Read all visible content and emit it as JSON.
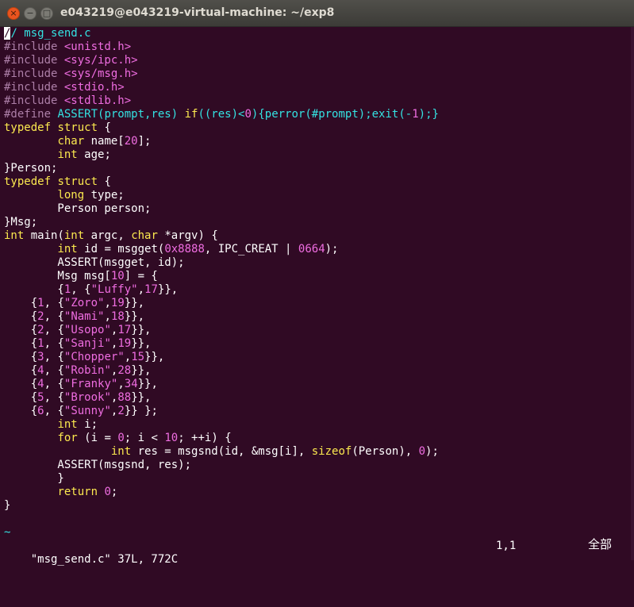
{
  "window": {
    "title": "e043219@e043219-virtual-machine: ~/exp8",
    "close_glyph": "×",
    "minimize_glyph": "−",
    "maximize_glyph": "□"
  },
  "colors": {
    "background": "#300a24",
    "comment": "#34e2e2",
    "preproc": "#ad7fa8",
    "type": "#fce94f",
    "statement": "#fce94f",
    "constant": "#ef6de1",
    "identifier": "#ffffff"
  },
  "editor": {
    "lines": [
      [
        [
          "cursor",
          "/"
        ],
        [
          "comment",
          "/ msg_send.c"
        ]
      ],
      [
        [
          "preproc",
          "#include "
        ],
        [
          "string",
          "<unistd.h>"
        ]
      ],
      [
        [
          "preproc",
          "#include "
        ],
        [
          "string",
          "<sys/ipc.h>"
        ]
      ],
      [
        [
          "preproc",
          "#include "
        ],
        [
          "string",
          "<sys/msg.h>"
        ]
      ],
      [
        [
          "preproc",
          "#include "
        ],
        [
          "string",
          "<stdio.h>"
        ]
      ],
      [
        [
          "preproc",
          "#include "
        ],
        [
          "string",
          "<stdlib.h>"
        ]
      ],
      [
        [
          "preproc",
          "#define "
        ],
        [
          "comment",
          "ASSERT(prompt,res) "
        ],
        [
          "type",
          "if"
        ],
        [
          "comment",
          "((res)<"
        ],
        [
          "constant",
          "0"
        ],
        [
          "comment",
          "){perror(#prompt);exit(-"
        ],
        [
          "constant",
          "1"
        ],
        [
          "comment",
          ");}"
        ]
      ],
      [
        [
          "type",
          "typedef"
        ],
        [
          "plain",
          " "
        ],
        [
          "type",
          "struct"
        ],
        [
          "plain",
          " {"
        ]
      ],
      [
        [
          "plain",
          "        "
        ],
        [
          "type",
          "char"
        ],
        [
          "plain",
          " name["
        ],
        [
          "constant",
          "20"
        ],
        [
          "plain",
          "];"
        ]
      ],
      [
        [
          "plain",
          "        "
        ],
        [
          "type",
          "int"
        ],
        [
          "plain",
          " age;"
        ]
      ],
      [
        [
          "plain",
          "}Person;"
        ]
      ],
      [
        [
          "type",
          "typedef"
        ],
        [
          "plain",
          " "
        ],
        [
          "type",
          "struct"
        ],
        [
          "plain",
          " {"
        ]
      ],
      [
        [
          "plain",
          "        "
        ],
        [
          "type",
          "long"
        ],
        [
          "plain",
          " type;"
        ]
      ],
      [
        [
          "plain",
          "        Person person;"
        ]
      ],
      [
        [
          "plain",
          "}Msg;"
        ]
      ],
      [
        [
          "type",
          "int"
        ],
        [
          "plain",
          " main("
        ],
        [
          "type",
          "int"
        ],
        [
          "plain",
          " argc, "
        ],
        [
          "type",
          "char"
        ],
        [
          "plain",
          " *argv) {"
        ]
      ],
      [
        [
          "plain",
          "        "
        ],
        [
          "type",
          "int"
        ],
        [
          "plain",
          " id = msgget("
        ],
        [
          "constant",
          "0x8888"
        ],
        [
          "plain",
          ", IPC_CREAT | "
        ],
        [
          "constant",
          "0664"
        ],
        [
          "plain",
          ");"
        ]
      ],
      [
        [
          "plain",
          "        ASSERT(msgget, id);"
        ]
      ],
      [
        [
          "plain",
          "        Msg msg["
        ],
        [
          "constant",
          "10"
        ],
        [
          "plain",
          "] = {"
        ]
      ],
      [
        [
          "plain",
          "        {"
        ],
        [
          "constant",
          "1"
        ],
        [
          "plain",
          ", {"
        ],
        [
          "constant",
          "\"Luffy\""
        ],
        [
          "plain",
          ","
        ],
        [
          "constant",
          "17"
        ],
        [
          "plain",
          "}},"
        ]
      ],
      [
        [
          "plain",
          "    {"
        ],
        [
          "constant",
          "1"
        ],
        [
          "plain",
          ", {"
        ],
        [
          "constant",
          "\"Zoro\""
        ],
        [
          "plain",
          ","
        ],
        [
          "constant",
          "19"
        ],
        [
          "plain",
          "}},"
        ]
      ],
      [
        [
          "plain",
          "    {"
        ],
        [
          "constant",
          "2"
        ],
        [
          "plain",
          ", {"
        ],
        [
          "constant",
          "\"Nami\""
        ],
        [
          "plain",
          ","
        ],
        [
          "constant",
          "18"
        ],
        [
          "plain",
          "}},"
        ]
      ],
      [
        [
          "plain",
          "    {"
        ],
        [
          "constant",
          "2"
        ],
        [
          "plain",
          ", {"
        ],
        [
          "constant",
          "\"Usopo\""
        ],
        [
          "plain",
          ","
        ],
        [
          "constant",
          "17"
        ],
        [
          "plain",
          "}},"
        ]
      ],
      [
        [
          "plain",
          "    {"
        ],
        [
          "constant",
          "1"
        ],
        [
          "plain",
          ", {"
        ],
        [
          "constant",
          "\"Sanji\""
        ],
        [
          "plain",
          ","
        ],
        [
          "constant",
          "19"
        ],
        [
          "plain",
          "}},"
        ]
      ],
      [
        [
          "plain",
          "    {"
        ],
        [
          "constant",
          "3"
        ],
        [
          "plain",
          ", {"
        ],
        [
          "constant",
          "\"Chopper\""
        ],
        [
          "plain",
          ","
        ],
        [
          "constant",
          "15"
        ],
        [
          "plain",
          "}},"
        ]
      ],
      [
        [
          "plain",
          "    {"
        ],
        [
          "constant",
          "4"
        ],
        [
          "plain",
          ", {"
        ],
        [
          "constant",
          "\"Robin\""
        ],
        [
          "plain",
          ","
        ],
        [
          "constant",
          "28"
        ],
        [
          "plain",
          "}},"
        ]
      ],
      [
        [
          "plain",
          "    {"
        ],
        [
          "constant",
          "4"
        ],
        [
          "plain",
          ", {"
        ],
        [
          "constant",
          "\"Franky\""
        ],
        [
          "plain",
          ","
        ],
        [
          "constant",
          "34"
        ],
        [
          "plain",
          "}},"
        ]
      ],
      [
        [
          "plain",
          "    {"
        ],
        [
          "constant",
          "5"
        ],
        [
          "plain",
          ", {"
        ],
        [
          "constant",
          "\"Brook\""
        ],
        [
          "plain",
          ","
        ],
        [
          "constant",
          "88"
        ],
        [
          "plain",
          "}},"
        ]
      ],
      [
        [
          "plain",
          "    {"
        ],
        [
          "constant",
          "6"
        ],
        [
          "plain",
          ", {"
        ],
        [
          "constant",
          "\"Sunny\""
        ],
        [
          "plain",
          ","
        ],
        [
          "constant",
          "2"
        ],
        [
          "plain",
          "}} };"
        ]
      ],
      [
        [
          "plain",
          "        "
        ],
        [
          "type",
          "int"
        ],
        [
          "plain",
          " i;"
        ]
      ],
      [
        [
          "plain",
          "        "
        ],
        [
          "type",
          "for"
        ],
        [
          "plain",
          " (i = "
        ],
        [
          "constant",
          "0"
        ],
        [
          "plain",
          "; i < "
        ],
        [
          "constant",
          "10"
        ],
        [
          "plain",
          "; ++i) {"
        ]
      ],
      [
        [
          "plain",
          "                "
        ],
        [
          "type",
          "int"
        ],
        [
          "plain",
          " res = msgsnd(id, &msg[i], "
        ],
        [
          "type",
          "sizeof"
        ],
        [
          "plain",
          "(Person), "
        ],
        [
          "constant",
          "0"
        ],
        [
          "plain",
          ");"
        ]
      ],
      [
        [
          "plain",
          "        ASSERT(msgsnd, res);"
        ]
      ],
      [
        [
          "plain",
          "        }"
        ]
      ],
      [
        [
          "plain",
          "        "
        ],
        [
          "type",
          "return"
        ],
        [
          "plain",
          " "
        ],
        [
          "constant",
          "0"
        ],
        [
          "plain",
          ";"
        ]
      ],
      [
        [
          "plain",
          "}"
        ]
      ],
      [
        [
          "plain",
          ""
        ]
      ],
      [
        [
          "tilde",
          "~"
        ]
      ]
    ]
  },
  "statusbar": {
    "file_info": "\"msg_send.c\" 37L, 772C",
    "cursor_pos": "1,1",
    "scroll_pct": "全部"
  }
}
